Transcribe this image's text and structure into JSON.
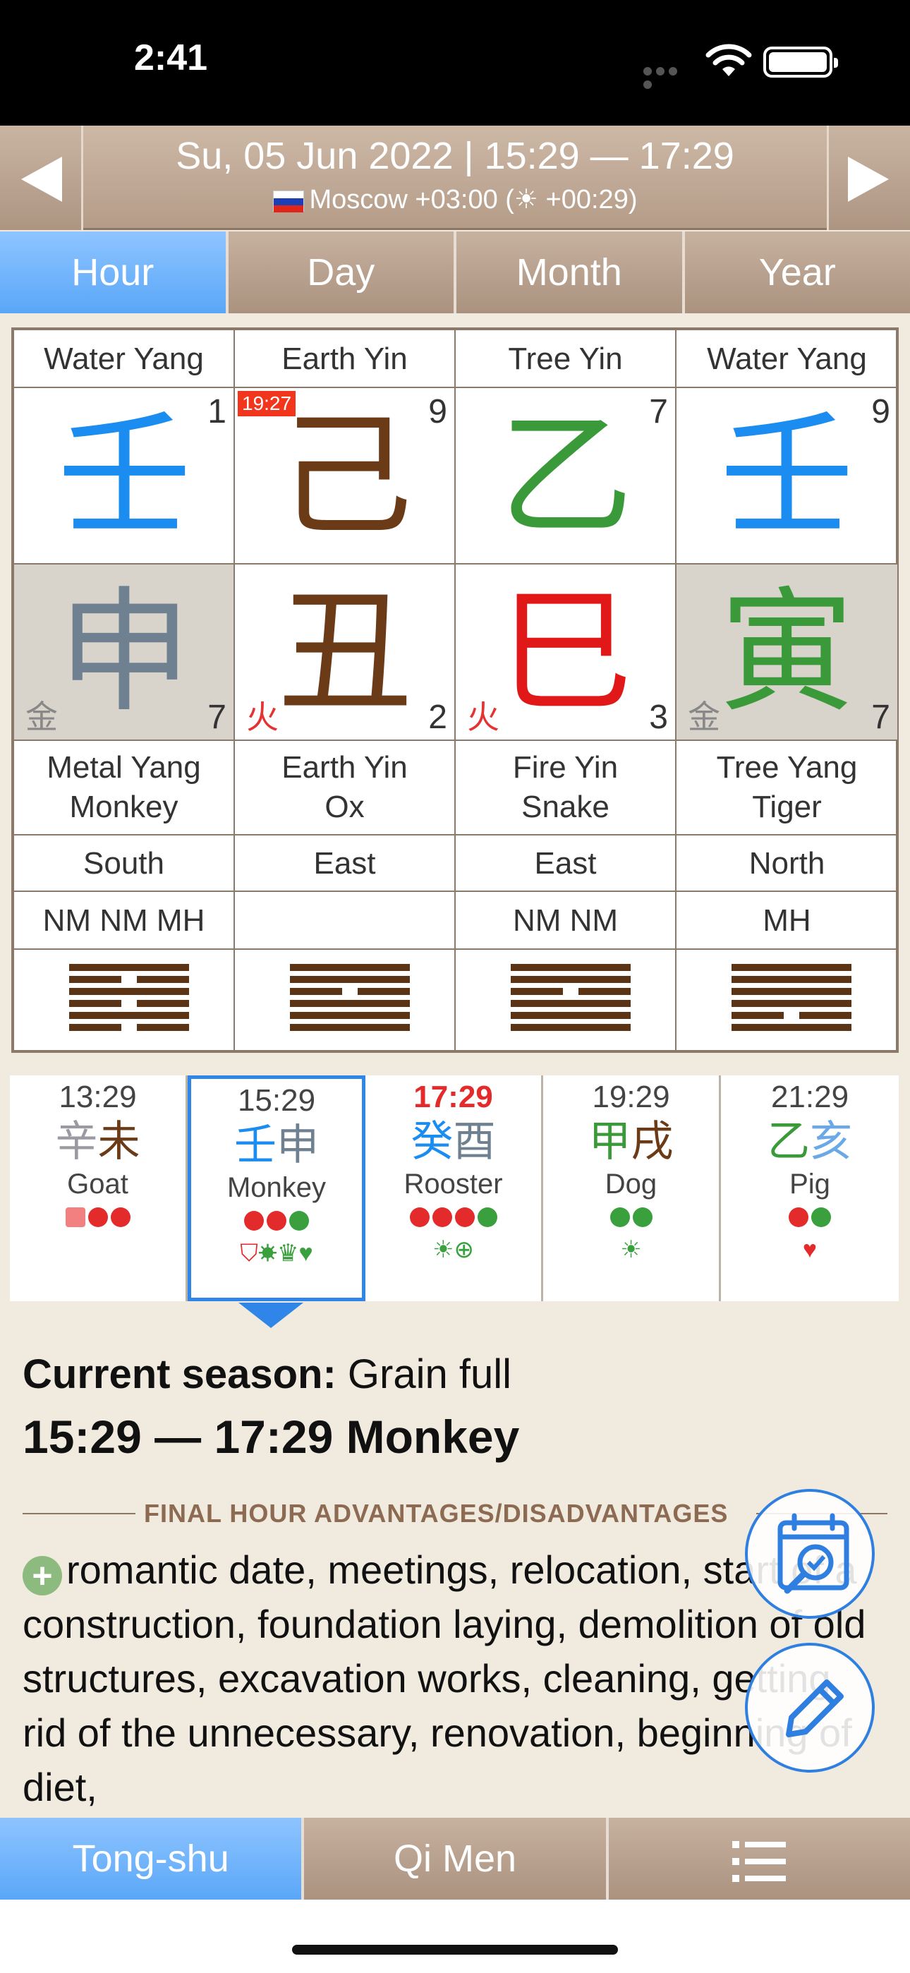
{
  "status": {
    "time": "2:41"
  },
  "header": {
    "date_line": "Su,  05 Jun 2022 |  15:29 — 17:29",
    "location": "Moscow +03:00 (☀ +00:29)"
  },
  "tabs": [
    "Hour",
    "Day",
    "Month",
    "Year"
  ],
  "pillars": [
    {
      "element": "Water Yang",
      "stem": "壬",
      "stem_color": "#1b8cf0",
      "stem_num": "1",
      "badge": "",
      "branch": "申",
      "branch_color": "#6f8090",
      "branch_bg": "gray",
      "branch_elem": "金",
      "branch_num": "7",
      "animal_l1": "Metal Yang",
      "animal_l2": "Monkey",
      "direction": "South",
      "stars": "NM NM MH",
      "hexagram": [
        1,
        0,
        1,
        0,
        1,
        0
      ]
    },
    {
      "element": "Earth Yin",
      "stem": "己",
      "stem_color": "#6b3a16",
      "stem_num": "9",
      "badge": "19:27",
      "branch": "丑",
      "branch_color": "#6b3a16",
      "branch_bg": "white",
      "branch_elem": "火",
      "branch_num": "2",
      "animal_l1": "Earth Yin",
      "animal_l2": "Ox",
      "direction": "East",
      "stars": "",
      "hexagram": [
        1,
        1,
        0,
        1,
        1,
        1
      ]
    },
    {
      "element": "Tree Yin",
      "stem": "乙",
      "stem_color": "#3a9a3a",
      "stem_num": "7",
      "badge": "",
      "branch": "巳",
      "branch_color": "#e01818",
      "branch_bg": "white",
      "branch_elem": "火",
      "branch_num": "3",
      "animal_l1": "Fire Yin",
      "animal_l2": "Snake",
      "direction": "East",
      "stars": "NM NM",
      "hexagram": [
        1,
        1,
        0,
        1,
        1,
        1
      ]
    },
    {
      "element": "Water Yang",
      "stem": "壬",
      "stem_color": "#1b8cf0",
      "stem_num": "9",
      "badge": "",
      "branch": "寅",
      "branch_color": "#3a9a3a",
      "branch_bg": "gray",
      "branch_elem": "金",
      "branch_num": "7",
      "animal_l1": "Tree Yang",
      "animal_l2": "Tiger",
      "direction": "North",
      "stars": "MH",
      "hexagram": [
        1,
        1,
        1,
        1,
        0,
        1
      ]
    }
  ],
  "hours": [
    {
      "time": "13:29",
      "red": false,
      "c1": "辛",
      "c1_color": "#9a9aa2",
      "c2": "未",
      "c2_color": "#6b3a16",
      "animal": "Goat",
      "dots": [
        "sq",
        "r",
        "r"
      ],
      "icons": ""
    },
    {
      "time": "15:29",
      "red": false,
      "c1": "壬",
      "c1_color": "#1b8cf0",
      "c2": "申",
      "c2_color": "#6f8090",
      "animal": "Monkey",
      "dots": [
        "r",
        "r",
        "g"
      ],
      "icons": "⛉☀♛♥"
    },
    {
      "time": "17:29",
      "red": true,
      "c1": "癸",
      "c1_color": "#1b8cf0",
      "c2": "酉",
      "c2_color": "#6f8090",
      "animal": "Rooster",
      "dots": [
        "r",
        "r",
        "r",
        "g"
      ],
      "icons": "☀⊕"
    },
    {
      "time": "19:29",
      "red": false,
      "c1": "甲",
      "c1_color": "#3a9a3a",
      "c2": "戌",
      "c2_color": "#6b3a16",
      "animal": "Dog",
      "dots": [
        "g",
        "g"
      ],
      "icons": "☀"
    },
    {
      "time": "21:29",
      "red": false,
      "c1": "乙",
      "c1_color": "#3a9a3a",
      "c2": "亥",
      "c2_color": "#6aa8e8",
      "animal": "Pig",
      "dots": [
        "r",
        "g"
      ],
      "icons": "♥"
    }
  ],
  "season": {
    "label": "Current season:",
    "value": "Grain full"
  },
  "hour_title": "15:29 — 17:29 Monkey",
  "section_heading": "FINAL HOUR ADVANTAGES/DISADVANTAGES",
  "advantages": "romantic date, meetings, relocation, start of a construction, foundation laying, demolition of old structures, excavation works, cleaning, getting rid of the unnecessary, renovation, beginning of diet,",
  "bottom_tabs": [
    "Tong-shu",
    "Qi Men"
  ],
  "colors": {
    "accent": "#5aa7f8",
    "tab_bg": "#b49c88",
    "selection": "#2f86e8"
  }
}
